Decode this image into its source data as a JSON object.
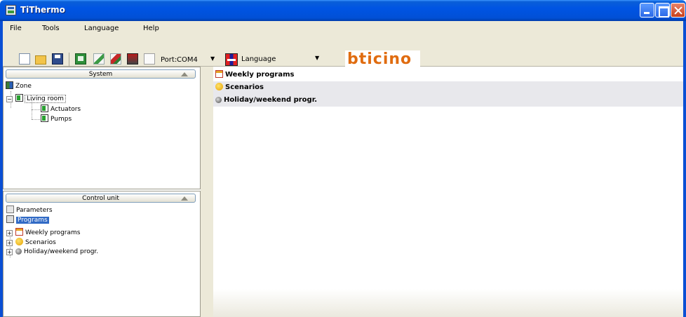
{
  "window": {
    "title": "TiThermo",
    "controls": [
      "minimize",
      "maximize",
      "close"
    ]
  },
  "menu": [
    "File",
    "Tools",
    "Language",
    "Help"
  ],
  "toolbar": {
    "icons": [
      "new-icon",
      "open-folder-icon",
      "save-icon",
      "check-icon",
      "send-icon",
      "receive-icon",
      "erase-icon",
      "document-icon",
      "language-flag-icon"
    ],
    "port_label": "Port:",
    "port_value": "COM4",
    "language_label": "Language",
    "brand": "bticino"
  },
  "system_panel": {
    "header": "System",
    "tree": {
      "root": "Zone",
      "room": "Living room",
      "children": [
        "Actuators",
        "Pumps"
      ]
    }
  },
  "control_panel": {
    "header": "Control unit",
    "parameters": "Parameters",
    "programs": "Programs",
    "program_items": [
      "Weekly programs",
      "Scenarios",
      "Holiday/weekend progr."
    ]
  },
  "right_panel": {
    "items": [
      "Weekly programs",
      "Scenarios",
      "Holiday/weekend progr."
    ]
  },
  "colors": {
    "title_bar": "#0054e3",
    "selection": "#316ac5",
    "chrome": "#ece9d8",
    "brand": "#e06c10"
  }
}
